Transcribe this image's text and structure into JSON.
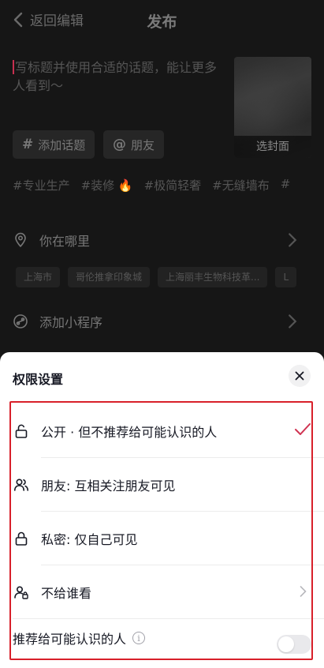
{
  "header": {
    "back_label": "返回编辑",
    "title": "发布"
  },
  "description": {
    "placeholder": "写标题并使用合适的话题，能让更多人看到～"
  },
  "cover": {
    "label": "选封面"
  },
  "chips": {
    "topic": {
      "symbol": "#",
      "label": "添加话题"
    },
    "friend": {
      "symbol": "@",
      "label": "朋友"
    }
  },
  "tags": [
    "#专业生产",
    "#装修 🔥",
    "#极简轻奢",
    "#无缝墙布",
    "#"
  ],
  "location": {
    "label": "你在哪里",
    "suggestions": [
      "上海市",
      "哥伦推拿印象城",
      "上海丽丰生物科技革...",
      "L"
    ]
  },
  "mini_program": {
    "label": "添加小程序"
  },
  "sheet": {
    "title": "权限设置",
    "options": [
      {
        "label": "公开 · 但不推荐给可能认识的人",
        "selected": true
      },
      {
        "label": "朋友: 互相关注朋友可见",
        "selected": false
      },
      {
        "label": "私密: 仅自己可见",
        "selected": false
      },
      {
        "label": "不给谁看",
        "selected": false
      }
    ],
    "recommend": {
      "label": "推荐给可能认识的人",
      "info_symbol": "i",
      "enabled": false
    }
  },
  "colors": {
    "accent": "#d03452",
    "highlight_border": "#d8202a",
    "sheet_bg": "#ffffff",
    "overlay_bg": "#161616"
  }
}
